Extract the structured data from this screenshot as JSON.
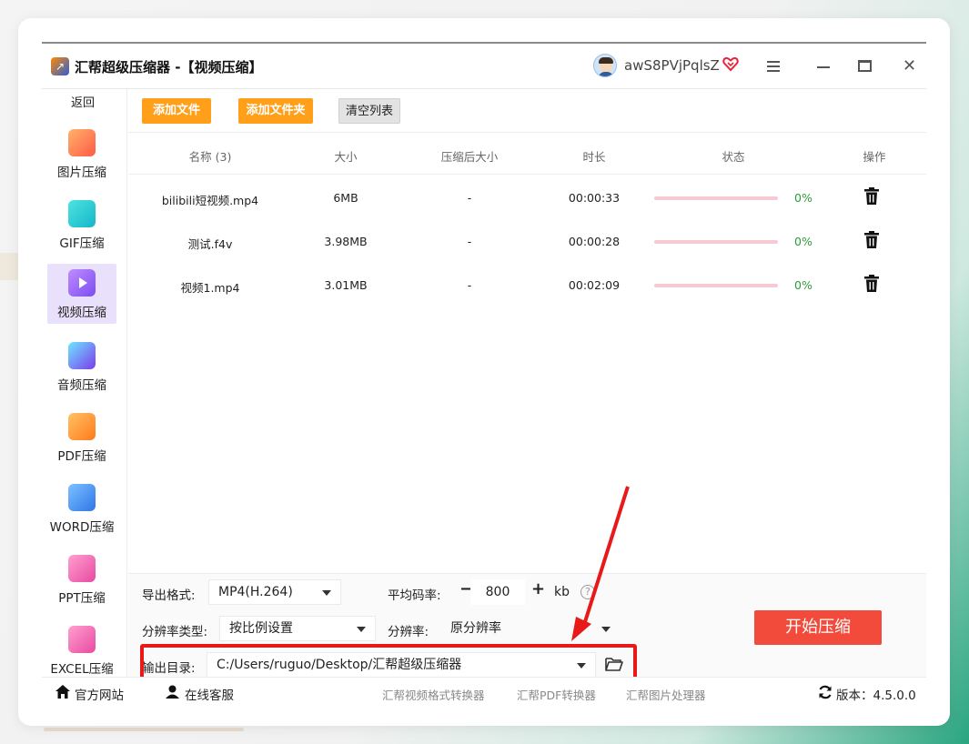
{
  "window": {
    "title": "汇帮超级压缩器  -【视频压缩】",
    "username": "awS8PVjPqlsZ",
    "icons": [
      "user-avatar",
      "vip-heart-icon",
      "menu-icon",
      "minimize-icon",
      "maximize-icon",
      "close-icon"
    ]
  },
  "sidebar": {
    "back_label": "返回",
    "items": [
      {
        "label": "图片压缩",
        "icon": "image-compress-icon",
        "color": "#ff6b4a"
      },
      {
        "label": "GIF压缩",
        "icon": "gif-compress-icon",
        "color": "#1fc7d4"
      },
      {
        "label": "视频压缩",
        "icon": "video-compress-icon",
        "color": "#8b5cf6",
        "active": true
      },
      {
        "label": "音频压缩",
        "icon": "audio-compress-icon",
        "color": "#6366f1"
      },
      {
        "label": "PDF压缩",
        "icon": "pdf-compress-icon",
        "color": "#ff8a3d"
      },
      {
        "label": "WORD压缩",
        "icon": "word-compress-icon",
        "color": "#3b82f6"
      },
      {
        "label": "PPT压缩",
        "icon": "ppt-compress-icon",
        "color": "#f05ca8"
      },
      {
        "label": "EXCEL压缩",
        "icon": "excel-compress-icon",
        "color": "#f05ca8"
      }
    ]
  },
  "toolbar": {
    "add_file": "添加文件",
    "add_folder": "添加文件夹",
    "clear_list": "清空列表"
  },
  "table": {
    "headers": [
      "名称 (3)",
      "大小",
      "压缩后大小",
      "时长",
      "状态",
      "操作"
    ],
    "rows": [
      {
        "name": "bilibili短视频.mp4",
        "size": "6MB",
        "compressed": "-",
        "duration": "00:00:33",
        "progress": 0,
        "percent": "0%"
      },
      {
        "name": "测试.f4v",
        "size": "3.98MB",
        "compressed": "-",
        "duration": "00:00:28",
        "progress": 0,
        "percent": "0%"
      },
      {
        "name": "视频1.mp4",
        "size": "3.01MB",
        "compressed": "-",
        "duration": "00:02:09",
        "progress": 0,
        "percent": "0%"
      }
    ]
  },
  "settings": {
    "format_label": "导出格式:",
    "format_value": "MP4(H.264)",
    "bitrate_label": "平均码率:",
    "bitrate_value": "800",
    "bitrate_unit": "kb",
    "minus": "−",
    "plus": "+",
    "help": "?",
    "res_type_label": "分辨率类型:",
    "res_type_value": "按比例设置",
    "res_label": "分辨率:",
    "res_value": "原分辨率",
    "output_label": "输出目录:",
    "output_value": "C:/Users/ruguo/Desktop/汇帮超级压缩器",
    "start_button": "开始压缩"
  },
  "statusbar": {
    "website": "官方网站",
    "support": "在线客服",
    "link1": "汇帮视频格式转换器",
    "link2": "汇帮PDF转换器",
    "link3": "汇帮图片处理器",
    "version": "版本：4.5.0.0"
  },
  "colors": {
    "accent_orange": "#ff9f1a",
    "start_red": "#f24b3b",
    "highlight_red": "#e81919",
    "progress_pink": "#f7c9d2",
    "percent_green": "#2e9b3a",
    "active_nav": "#e9e1fb"
  }
}
